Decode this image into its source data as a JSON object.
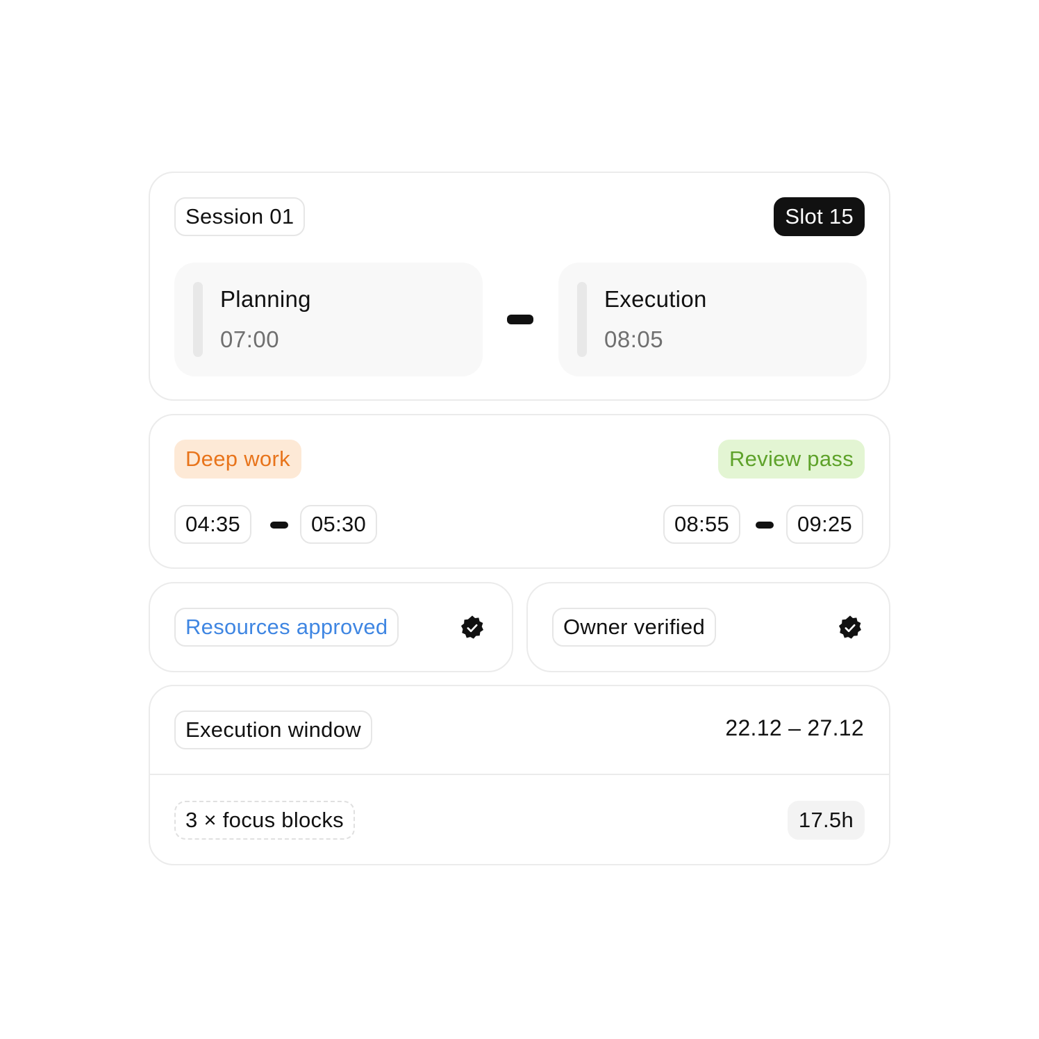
{
  "schedule": {
    "session_label": "Session 01",
    "slot_label": "Slot 15",
    "stages": [
      {
        "name": "Planning",
        "time": "07:00"
      },
      {
        "name": "Execution",
        "time": "08:05"
      }
    ]
  },
  "blocks": {
    "left": {
      "tag": "Deep work",
      "start": "04:35",
      "end": "05:30",
      "tag_color": "#e8741b",
      "tag_bg": "#fde9d6"
    },
    "right": {
      "tag": "Review pass",
      "start": "08:55",
      "end": "09:25",
      "tag_color": "#5ea22a",
      "tag_bg": "#e3f5d3"
    }
  },
  "checks": {
    "resources": {
      "label": "Resources approved",
      "icon": "verified-badge-icon",
      "label_color": "#3f86e2"
    },
    "owner": {
      "label": "Owner verified",
      "icon": "verified-badge-icon"
    }
  },
  "window": {
    "label": "Execution window",
    "dates": "22.12 – 27.12",
    "focus_label": "3 × focus blocks",
    "total": "17.5h"
  }
}
